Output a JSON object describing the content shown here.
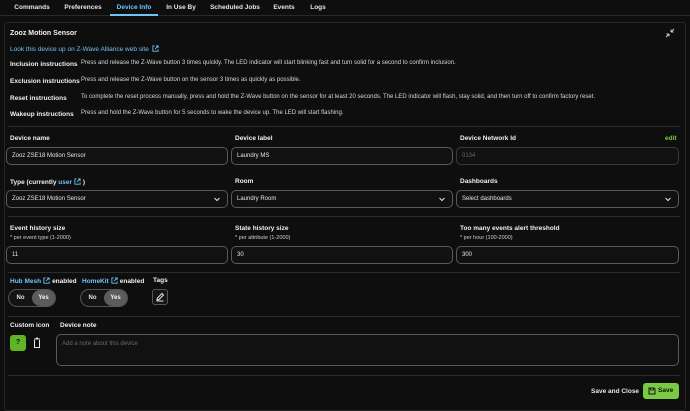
{
  "tabs": [
    {
      "label": "Commands",
      "active": false
    },
    {
      "label": "Preferences",
      "active": false
    },
    {
      "label": "Device Info",
      "active": true
    },
    {
      "label": "In Use By",
      "active": false
    },
    {
      "label": "Scheduled Jobs",
      "active": false
    },
    {
      "label": "Events",
      "active": false
    },
    {
      "label": "Logs",
      "active": false
    }
  ],
  "device": {
    "title": "Zooz Motion Sensor",
    "lookup_link": "Look this device up on Z-Wave Alliance web site"
  },
  "instructions": [
    {
      "label": "Inclusion instructions",
      "text": "Press and release the Z-Wave button 3 times quickly. The LED indicator will start blinking fast and turn solid for a second to confirm inclusion."
    },
    {
      "label": "Exclusion instructions",
      "text": "Press and release the Z-Wave button on the sensor 3 times as quickly as possible."
    },
    {
      "label": "Reset instructions",
      "text": "To complete the reset process manually, press and hold the Z-Wave button on the sensor for at least 20 seconds. The LED indicator will flash, stay solid, and then turn off to confirm factory reset."
    },
    {
      "label": "Wakeup instructions",
      "text": "Press and hold the Z-Wave button for 5 seconds to wake the device up. The LED will start flashing."
    }
  ],
  "fields": {
    "device_name": {
      "label": "Device name",
      "value": "Zooz ZSE18 Motion Sensor"
    },
    "device_label": {
      "label": "Device label",
      "value": "Laundry MS"
    },
    "network_id": {
      "label": "Device Network Id",
      "placeholder": "0134",
      "edit_label": "edit"
    },
    "type": {
      "label_prefix": "Type (currently ",
      "label_link": "user",
      "label_suffix": " )",
      "value": "Zooz ZSE18 Motion Sensor"
    },
    "room": {
      "label": "Room",
      "value": "Laundry Room"
    },
    "dashboards": {
      "label": "Dashboards",
      "value": "Select dashboards"
    },
    "event_history": {
      "label": "Event history size",
      "hint": "* per event type (1-2000)",
      "value": "11"
    },
    "state_history": {
      "label": "State history size",
      "hint": "* per attribute (1-2000)",
      "value": "30"
    },
    "events_threshold": {
      "label": "Too many events alert threshold",
      "hint": "* per hour (100-2000)",
      "value": "300"
    }
  },
  "hub_mesh": {
    "link": "Hub Mesh",
    "suffix": "enabled",
    "no": "No",
    "yes": "Yes",
    "selected": "Yes"
  },
  "homekit": {
    "link": "HomeKit",
    "suffix": "enabled",
    "no": "No",
    "yes": "Yes",
    "selected": "Yes"
  },
  "tags": {
    "label": "Tags"
  },
  "custom_icon": {
    "label": "Custom icon",
    "glyph": "?"
  },
  "device_note": {
    "label": "Device note",
    "placeholder": "Add a note about this device"
  },
  "footer": {
    "save_close": "Save and Close",
    "save": "Save"
  },
  "icons": {
    "external": "external-link-icon",
    "collapse": "collapse-icon",
    "tag": "tag-edit-icon",
    "trash": "trash-icon",
    "save": "save-icon"
  },
  "colors": {
    "accent": "#6fc3f7",
    "save_green": "#7ac943",
    "icon_green": "#5fb526"
  }
}
